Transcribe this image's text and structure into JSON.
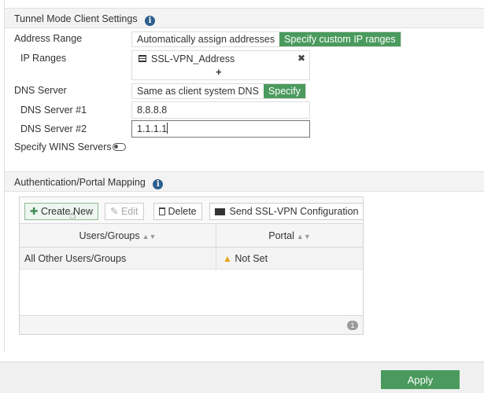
{
  "tunnel": {
    "title": "Tunnel Mode Client Settings",
    "address_range_label": "Address Range",
    "address_range_options": [
      "Automatically assign addresses",
      "Specify custom IP ranges"
    ],
    "ip_ranges_label": "IP Ranges",
    "ip_range_entry": "SSL-VPN_Address",
    "add_symbol": "+",
    "remove_symbol": "✖",
    "dns_server_label": "DNS Server",
    "dns_options": [
      "Same as client system DNS",
      "Specify"
    ],
    "dns1_label": "DNS Server #1",
    "dns1_value": "8.8.8.8",
    "dns2_label": "DNS Server #2",
    "dns2_value": "1.1.1.1",
    "wins_label": "Specify WINS Servers"
  },
  "auth": {
    "title": "Authentication/Portal Mapping",
    "toolbar": {
      "create": "Create New",
      "edit": "Edit",
      "delete": "Delete",
      "send": "Send SSL-VPN Configuration"
    },
    "columns": [
      "Users/Groups",
      "Portal"
    ],
    "rows": [
      {
        "users": "All Other Users/Groups",
        "portal": "Not Set"
      }
    ],
    "count": "1"
  },
  "footer": {
    "apply": "Apply"
  },
  "colors": {
    "accent": "#4a9a5d",
    "info": "#2c5f8d",
    "warning": "#e8a317"
  }
}
